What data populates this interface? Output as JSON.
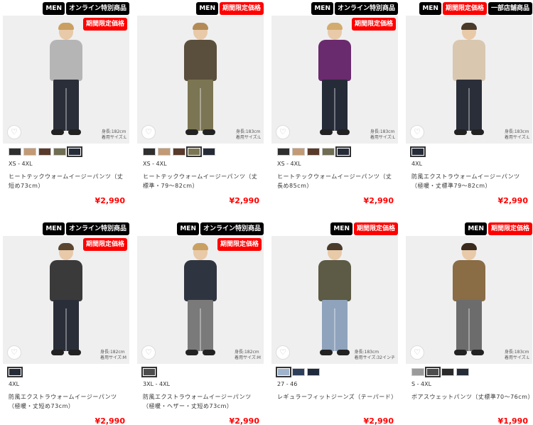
{
  "products": [
    {
      "badges": [
        {
          "text": "MEN",
          "color": "black"
        },
        {
          "text": "オンライン特別商品",
          "color": "black"
        }
      ],
      "photo_badge": "期間限定価格",
      "model": {
        "height": "身長:182cm",
        "size": "着用サイズ:L",
        "top_color": "#b5b5b5",
        "bottom_color": "#2a2e38",
        "hair": "#c9a062"
      },
      "swatches": [
        {
          "color": "#2f2f2f",
          "selected": false
        },
        {
          "color": "#c39a74",
          "selected": false
        },
        {
          "color": "#5a3a2a",
          "selected": false
        },
        {
          "color": "#6f6d52",
          "selected": false
        },
        {
          "color": "#262b38",
          "selected": true
        }
      ],
      "sizes": "XS - 4XL",
      "name": "ヒートテックウォームイージーパンツ（丈短め73cm）",
      "price": "¥2,990"
    },
    {
      "badges": [
        {
          "text": "MEN",
          "color": "black"
        },
        {
          "text": "期間限定価格",
          "color": "red"
        }
      ],
      "photo_badge": "",
      "model": {
        "height": "身長:183cm",
        "size": "着用サイズ:L",
        "top_color": "#5a4f3c",
        "bottom_color": "#7b7553",
        "hair": "#b38a55"
      },
      "swatches": [
        {
          "color": "#2f2f2f",
          "selected": false
        },
        {
          "color": "#c39a74",
          "selected": false
        },
        {
          "color": "#5a3a2a",
          "selected": false
        },
        {
          "color": "#7b7553",
          "selected": true
        },
        {
          "color": "#262b38",
          "selected": false
        }
      ],
      "sizes": "XS - 4XL",
      "name": "ヒートテックウォームイージーパンツ（丈標準・79～82cm）",
      "price": "¥2,990"
    },
    {
      "badges": [
        {
          "text": "MEN",
          "color": "black"
        },
        {
          "text": "オンライン特別商品",
          "color": "black"
        }
      ],
      "photo_badge": "期間限定価格",
      "model": {
        "height": "身長:183cm",
        "size": "着用サイズ:L",
        "top_color": "#6a2a6e",
        "bottom_color": "#262b38",
        "hair": "#d2ab6e"
      },
      "swatches": [
        {
          "color": "#2f2f2f",
          "selected": false
        },
        {
          "color": "#c39a74",
          "selected": false
        },
        {
          "color": "#5a3a2a",
          "selected": false
        },
        {
          "color": "#6f6d52",
          "selected": false
        },
        {
          "color": "#262b38",
          "selected": true
        }
      ],
      "sizes": "XS - 4XL",
      "name": "ヒートテックウォームイージーパンツ（丈長め85cm）",
      "price": "¥2,990"
    },
    {
      "badges": [
        {
          "text": "MEN",
          "color": "black"
        },
        {
          "text": "期間限定価格",
          "color": "red"
        },
        {
          "text": "一部店舗商品",
          "color": "black"
        }
      ],
      "photo_badge": "",
      "model": {
        "height": "身長:183cm",
        "size": "着用サイズ:L",
        "top_color": "#d9c7b0",
        "bottom_color": "#2a2e38",
        "hair": "#4a3a2a"
      },
      "swatches": [
        {
          "color": "#262b38",
          "selected": true
        }
      ],
      "sizes": "4XL",
      "name": "防風エクストラウォームイージーパンツ（極暖・丈標準79～82cm）",
      "price": "¥2,990"
    },
    {
      "badges": [
        {
          "text": "MEN",
          "color": "black"
        },
        {
          "text": "オンライン特別商品",
          "color": "black"
        }
      ],
      "photo_badge": "期間限定価格",
      "model": {
        "height": "身長:182cm",
        "size": "着用サイズ:M",
        "top_color": "#3a3a3a",
        "bottom_color": "#2a2e38",
        "hair": "#5a4530"
      },
      "swatches": [
        {
          "color": "#262b38",
          "selected": true
        }
      ],
      "sizes": "4XL",
      "name": "防風エクストラウォームイージーパンツ（極暖・丈短め73cm）",
      "price": "¥2,990"
    },
    {
      "badges": [
        {
          "text": "MEN",
          "color": "black"
        },
        {
          "text": "オンライン特別商品",
          "color": "black"
        }
      ],
      "photo_badge": "期間限定価格",
      "model": {
        "height": "身長:182cm",
        "size": "着用サイズ:M",
        "top_color": "#2f3540",
        "bottom_color": "#7a7a7a",
        "hair": "#c9a062"
      },
      "swatches": [
        {
          "color": "#4d4d4d",
          "selected": true
        }
      ],
      "sizes": "3XL - 4XL",
      "name": "防風エクストラウォームイージーパンツ（極暖・ヘザー・丈短め73cm）",
      "price": "¥2,990"
    },
    {
      "badges": [
        {
          "text": "MEN",
          "color": "black"
        },
        {
          "text": "期間限定価格",
          "color": "red"
        }
      ],
      "photo_badge": "",
      "model": {
        "height": "身長:183cm",
        "size": "着用サイズ:32インチ",
        "top_color": "#5d5a45",
        "bottom_color": "#8fa3bd",
        "hair": "#4a3a2a"
      },
      "swatches": [
        {
          "color": "#9fb4cc",
          "selected": true
        },
        {
          "color": "#2e3f5c",
          "selected": false
        },
        {
          "color": "#1f2a3d",
          "selected": false
        }
      ],
      "sizes": "27 - 46",
      "name": "レギュラーフィットジーンズ（テーパード）",
      "price": "¥2,990"
    },
    {
      "badges": [
        {
          "text": "MEN",
          "color": "black"
        },
        {
          "text": "期間限定価格",
          "color": "red"
        }
      ],
      "photo_badge": "",
      "model": {
        "height": "身長:183cm",
        "size": "着用サイズ:L",
        "top_color": "#8a6c45",
        "bottom_color": "#6c6c6c",
        "hair": "#3a2a1e"
      },
      "swatches": [
        {
          "color": "#9a9a9a",
          "selected": false
        },
        {
          "color": "#4d4d4d",
          "selected": true
        },
        {
          "color": "#2a2a2a",
          "selected": false
        },
        {
          "color": "#262b38",
          "selected": false
        }
      ],
      "sizes": "S - 4XL",
      "name": "ボアスウェットパンツ（丈標準70～76cm）",
      "price": "¥1,990"
    }
  ],
  "icons": {
    "favorite": "heart-icon"
  },
  "favorite_glyph": "♡"
}
